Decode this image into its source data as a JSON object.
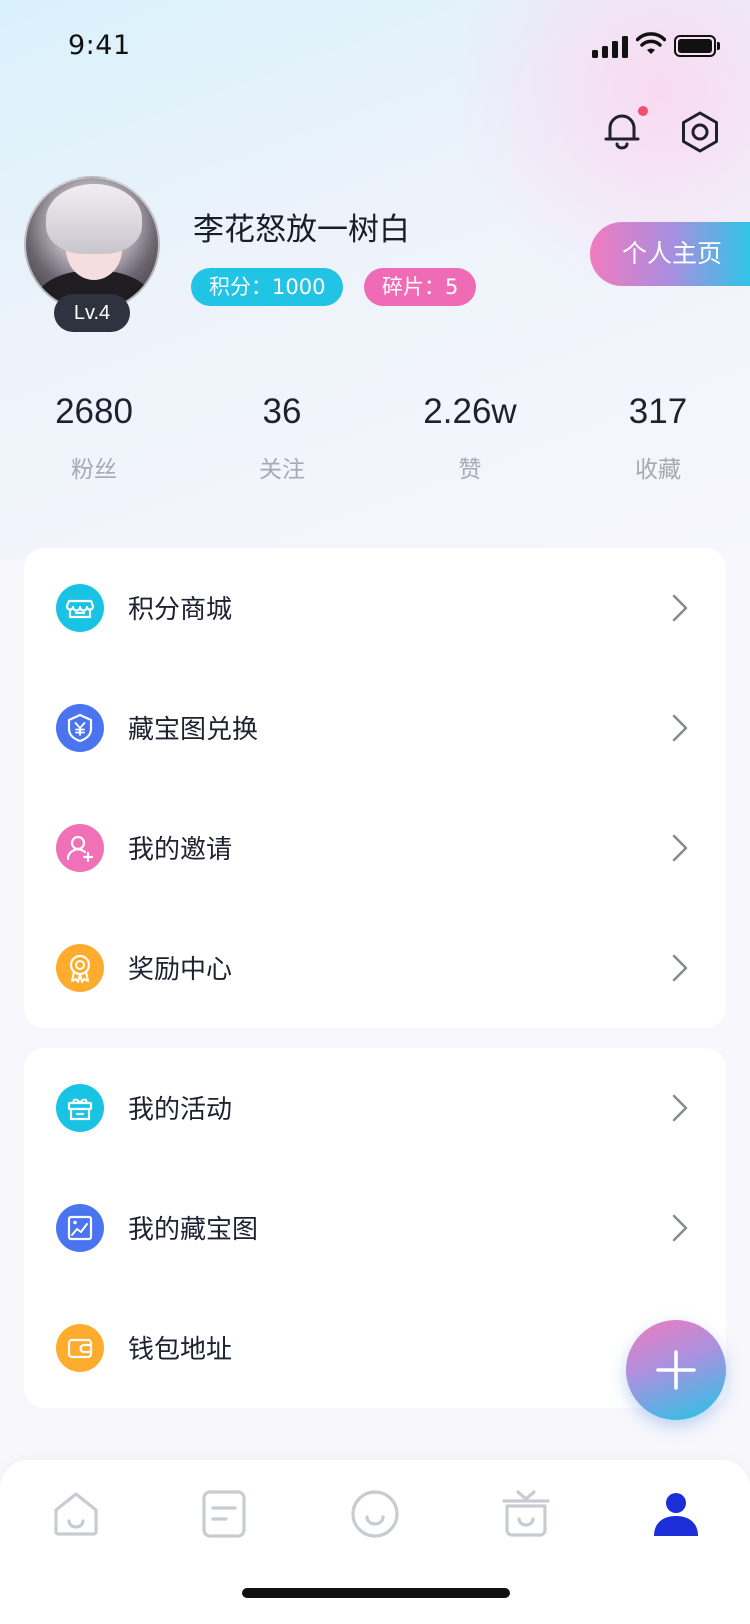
{
  "status_bar": {
    "time": "9:41"
  },
  "header": {
    "notification_dot_color": "#f0506e"
  },
  "profile": {
    "username": "李花怒放一树白",
    "level": "Lv.4",
    "points_chip": "积分：1000",
    "shards_chip": "碎片：5",
    "home_button": "个人主页"
  },
  "stats": [
    {
      "value": "2680",
      "label": "粉丝"
    },
    {
      "value": "36",
      "label": "关注"
    },
    {
      "value": "2.26w",
      "label": "赞"
    },
    {
      "value": "317",
      "label": "收藏"
    }
  ],
  "menu_group_1": [
    {
      "label": "积分商城",
      "icon": "store-icon",
      "color": "#19c3e3"
    },
    {
      "label": "藏宝图兑换",
      "icon": "yuan-shield-icon",
      "color": "#4a74f0"
    },
    {
      "label": "我的邀请",
      "icon": "user-add-icon",
      "color": "#f071b8"
    },
    {
      "label": "奖励中心",
      "icon": "award-icon",
      "color": "#ffac2e"
    }
  ],
  "menu_group_2": [
    {
      "label": "我的活动",
      "icon": "gift-icon",
      "color": "#19c3e3"
    },
    {
      "label": "我的藏宝图",
      "icon": "picture-icon",
      "color": "#4a74f0"
    },
    {
      "label": "钱包地址",
      "icon": "wallet-icon",
      "color": "#ffac2e"
    }
  ],
  "tabbar": {
    "items": [
      "home-tab-icon",
      "notes-tab-icon",
      "smile-tab-icon",
      "tv-tab-icon",
      "profile-tab-icon"
    ],
    "active_color": "#1c2ed6",
    "inactive_color": "#c9cbd3"
  },
  "colors": {
    "accent_cyan": "#22c4e5",
    "accent_pink": "#f06bb5"
  }
}
